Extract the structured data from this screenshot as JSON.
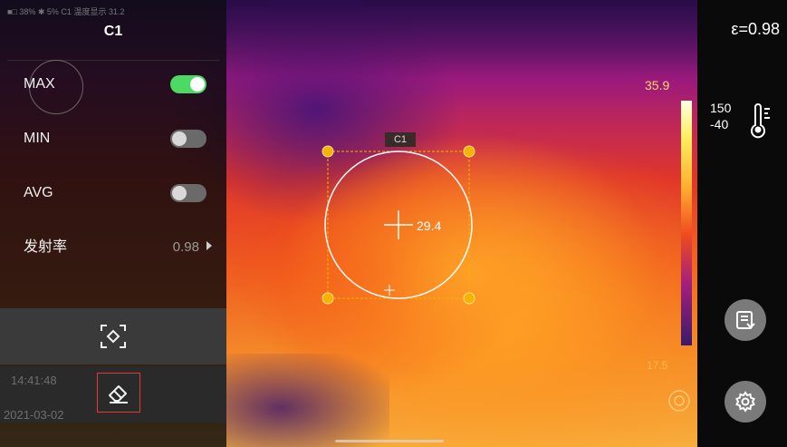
{
  "status_bar": {
    "text": "■□ 38%  ✱ 5%  C1  温度显示 31.2"
  },
  "panel": {
    "title": "C1",
    "rows": [
      {
        "label": "MAX",
        "toggle": "on"
      },
      {
        "label": "MIN",
        "toggle": "off"
      },
      {
        "label": "AVG",
        "toggle": "off"
      },
      {
        "label": "发射率",
        "value": "0.98"
      }
    ],
    "time": "14:41:48",
    "date": "2021-03-02"
  },
  "measurement": {
    "label": "C1",
    "center_value": "29.4"
  },
  "scale": {
    "high": "35.9",
    "low": "17.5"
  },
  "right": {
    "emissivity": "ε=0.98",
    "range_high": "150",
    "range_low": "-40"
  },
  "icons": [
    "focus-region-icon",
    "eraser-icon",
    "gallery-icon",
    "settings-gear-icon",
    "thermometer-icon"
  ],
  "colors": {
    "toggle_on": "#4cd964",
    "highlight_box": "#e53935",
    "handle": "#f5b400"
  }
}
